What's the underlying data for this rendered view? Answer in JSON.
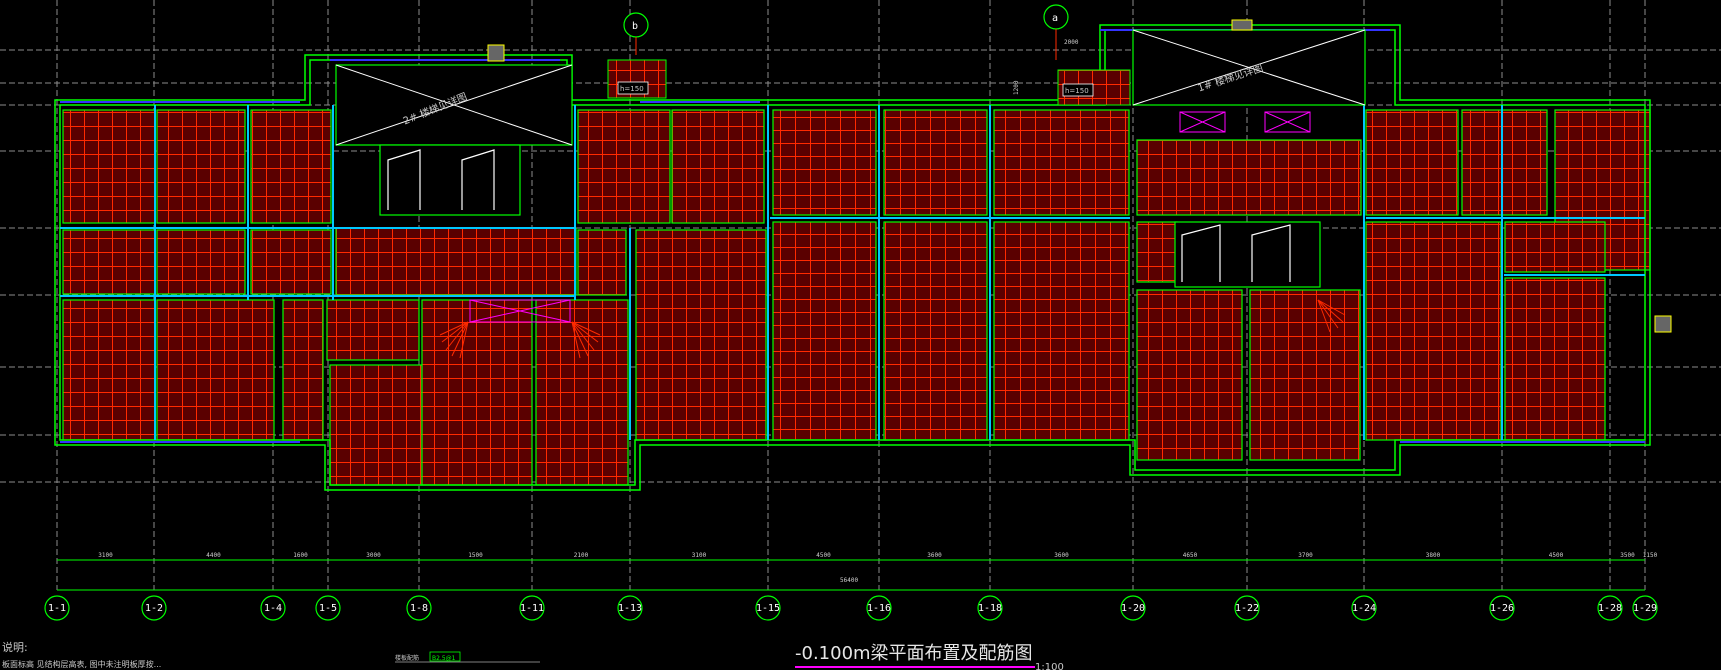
{
  "drawing": {
    "title": "-0.100m梁平面布置及配筋图",
    "scale": "1:100",
    "notes_heading": "说明:",
    "notes_line": "板面标高 见结构层高表, 图中未注明板厚按...",
    "legend_label": "楼板配筋",
    "legend_value": "B2.5@1",
    "stair_1": "1# 楼梯见详图",
    "stair_2": "2# 楼梯见详图",
    "h_label": "h=150",
    "h_label_2": "h=150",
    "dim_2000": "2000",
    "dim_1200": "1200",
    "total_dim": "56400"
  },
  "gridlines": {
    "bubbles_top": [
      "b",
      "a"
    ],
    "axes": [
      "1-1",
      "1-2",
      "1-4",
      "1-5",
      "1-8",
      "1-11",
      "1-13",
      "1-15",
      "1-16",
      "1-18",
      "1-20",
      "1-22",
      "1-24",
      "1-26",
      "1-28",
      "1-29"
    ],
    "spans": [
      "3100",
      "4400",
      "1600",
      "3000",
      "1500",
      "2100",
      "3100",
      "4500",
      "3600",
      "3600",
      "4650",
      "3700",
      "3800",
      "4500",
      "3500",
      "1150"
    ]
  },
  "colors": {
    "background": "#000000",
    "wall": "#00ff00",
    "beam_cyan": "#00c8ff",
    "beam_blue": "#3333ff",
    "rebar": "#ff2a00",
    "hatch": "#5a0000",
    "axis_bubble": "#00ff00",
    "magenta": "#ff00ff",
    "gray_grid": "#9a9a9a",
    "title_underline": "#ff00ff"
  }
}
